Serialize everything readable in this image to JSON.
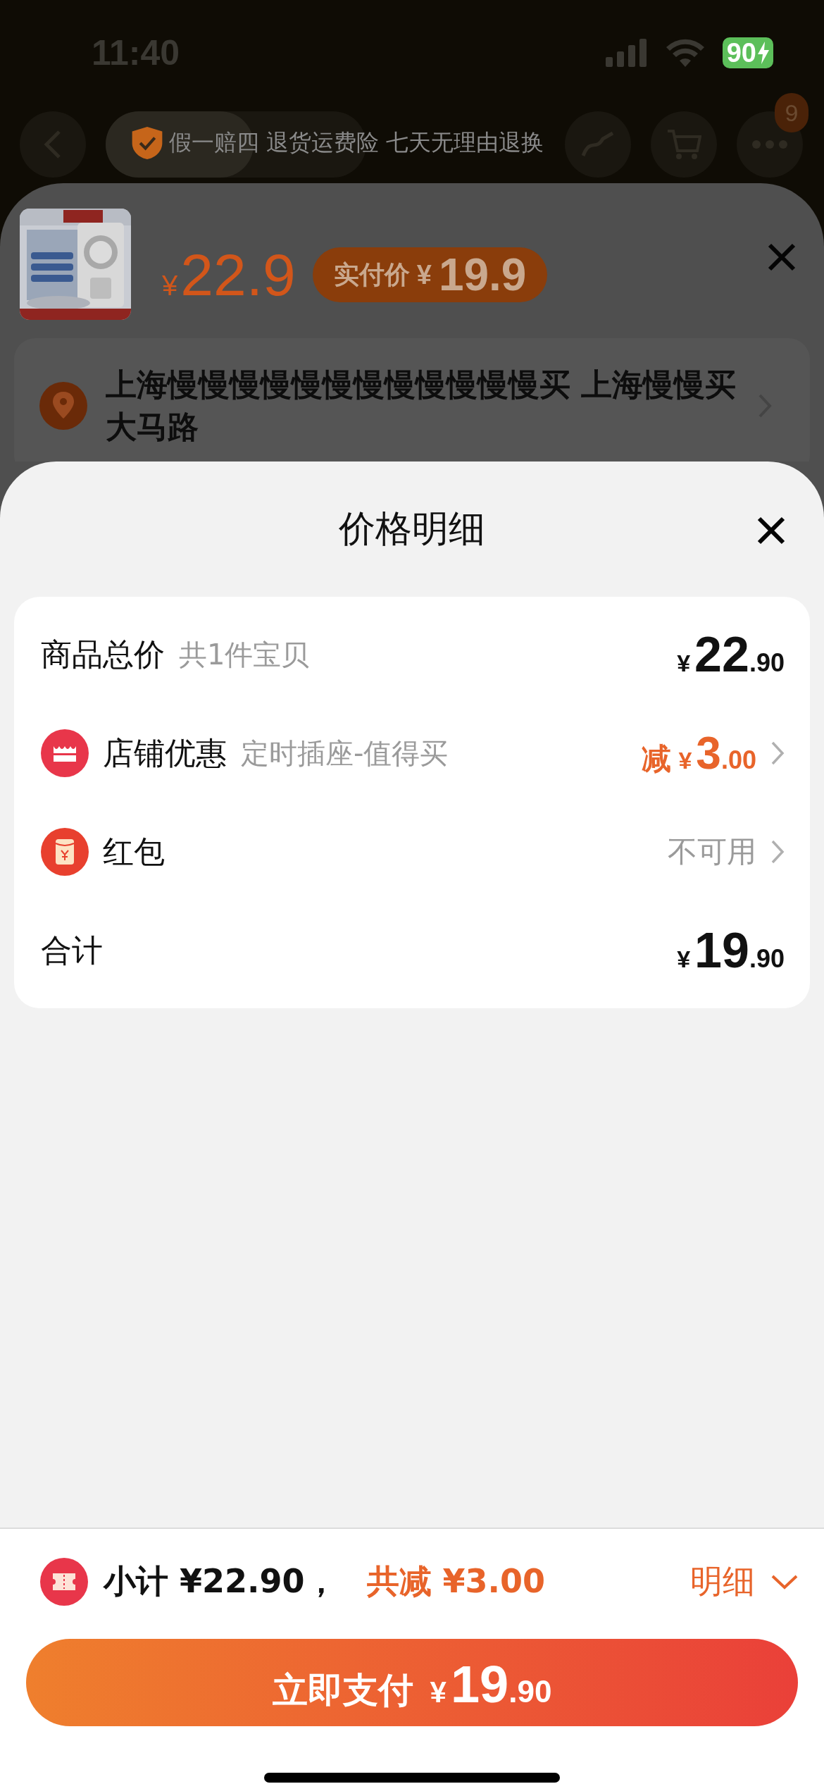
{
  "status_bar": {
    "time": "11:40",
    "battery": "90",
    "charging": true
  },
  "header": {
    "guarantee": "假一赔四 退货运费险 七天无理由退换",
    "more_badge": "9"
  },
  "product_sheet": {
    "price": {
      "currency": "¥",
      "amount": "22.9"
    },
    "paid_price": {
      "label": "实付价",
      "currency": "¥",
      "amount": "19.9"
    },
    "address": "上海慢慢慢慢慢慢慢慢慢慢慢慢买 上海慢慢买大马路"
  },
  "price_detail": {
    "title": "价格明细",
    "rows": [
      {
        "kind": "amount",
        "label": "商品总价",
        "note": "共1件宝贝",
        "currency": "¥",
        "integer": "22",
        "decimal": ".90"
      },
      {
        "kind": "discount",
        "label": "店铺优惠",
        "note": "定时插座-值得买",
        "prefix": "减",
        "currency": "¥",
        "integer": "3",
        "decimal": ".00"
      },
      {
        "kind": "status",
        "label": "红包",
        "value": "不可用"
      },
      {
        "kind": "amount",
        "label": "合计",
        "currency": "¥",
        "integer": "19",
        "decimal": ".90"
      }
    ]
  },
  "footer": {
    "subtotal": "小计 ¥22.90，",
    "reduction": "共减 ¥3.00",
    "detail_toggle": "明细",
    "pay_button": {
      "label": "立即支付",
      "currency": "¥",
      "integer": "19",
      "decimal": ".90"
    }
  }
}
